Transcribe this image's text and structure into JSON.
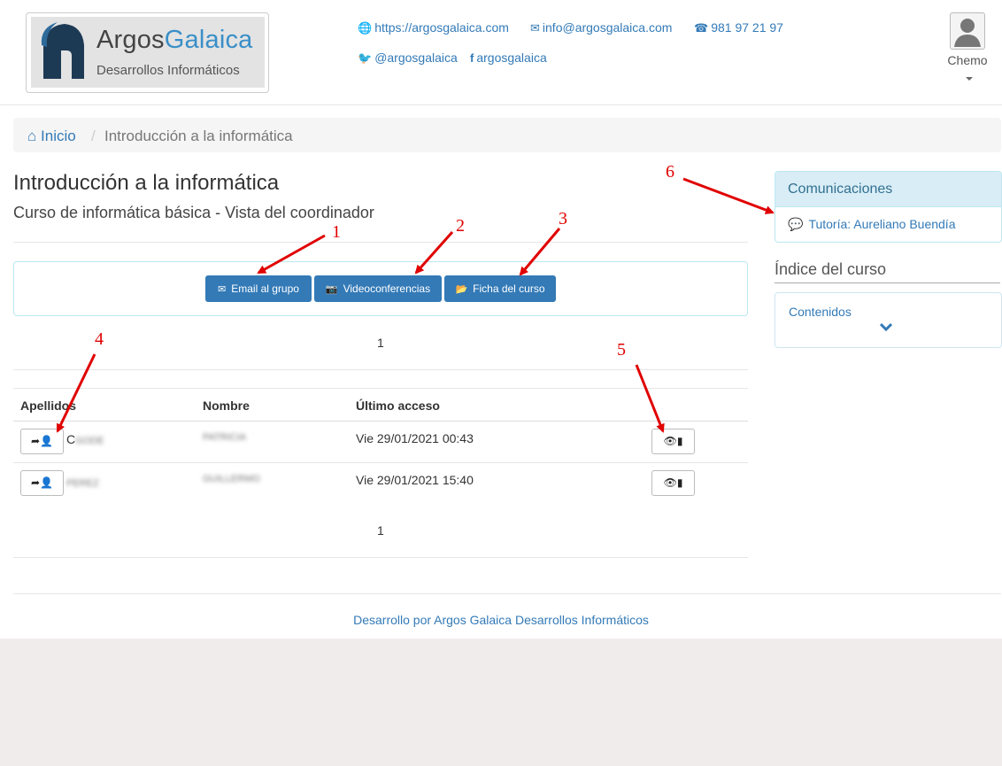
{
  "header": {
    "logo": {
      "name_part1": "Argos",
      "name_part2": "Galaica",
      "subtitle": "Desarrollos Informáticos"
    },
    "contacts": [
      {
        "icon": "globe-icon",
        "glyph": "🌐",
        "text": "https://argosgalaica.com"
      },
      {
        "icon": "envelope-icon",
        "glyph": "✉",
        "text": "info@argosgalaica.com"
      },
      {
        "icon": "phone-icon",
        "glyph": "☎",
        "text": "981 97 21 97"
      },
      {
        "icon": "twitter-icon",
        "glyph": "🐦",
        "text": "@argosgalaica"
      },
      {
        "icon": "facebook-icon",
        "glyph": "f",
        "text": "argosgalaica"
      }
    ],
    "user": {
      "name": "Chemo"
    }
  },
  "breadcrumb": {
    "home": "Inicio",
    "separator": "/",
    "current": "Introducción a la informática"
  },
  "main": {
    "title": "Introducción a la informática",
    "subtitle": "Curso de informática básica - Vista del coordinador",
    "buttons": [
      {
        "icon": "envelope-icon",
        "glyph": "✉",
        "label": "Email al grupo"
      },
      {
        "icon": "camera-icon",
        "glyph": "📷",
        "label": "Videoconferencias"
      },
      {
        "icon": "folder-open-icon",
        "glyph": "📂",
        "label": "Ficha del curso"
      }
    ],
    "pager_top": "1",
    "pager_bottom": "1",
    "table": {
      "columns": [
        "Apellidos",
        "Nombre",
        "Último acceso"
      ],
      "rows": [
        {
          "surname_prefix": "C",
          "surname_blur": "GODE",
          "name_blur": "PATRICIA",
          "last_access": "Vie 29/01/2021 00:43"
        },
        {
          "surname_prefix": "",
          "surname_blur": "PEREZ",
          "name_blur": "GUILLERMO",
          "last_access": "Vie 29/01/2021 15:40"
        }
      ]
    }
  },
  "sidebar": {
    "communications": {
      "title": "Comunicaciones",
      "item": "Tutoría: Aureliano Buendía"
    },
    "index": {
      "title": "Índice del curso",
      "contents_label": "Contenidos"
    }
  },
  "footer": {
    "text": "Desarrollo por Argos Galaica Desarrollos Informáticos"
  },
  "annotations": [
    "1",
    "2",
    "3",
    "4",
    "5",
    "6"
  ],
  "colors": {
    "link": "#337ab7",
    "button": "#337ab7",
    "panel_heading": "#d9edf7",
    "annotation": "#e00000"
  }
}
